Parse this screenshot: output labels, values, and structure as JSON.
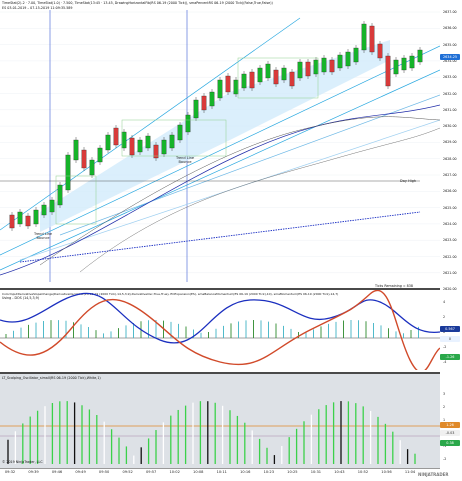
{
  "price_chart": {
    "header_line1": "TimeStat(2)-2 · 7.00, TimeStat(1.0) · 7.500, TimeStat(13:45 · 13.45, DrawingHorizontalFib(RS 06-19 (2000 Tick)), smaPercentRS 06-19 (2000 Tick)(False,True,False))",
    "header_line2": "ES 03-01-2019 – 07-15-2019 11:09:35.589",
    "price_ticks": [
      "2637.00",
      "2636.00",
      "2635.00",
      "2634.00",
      "2633.00",
      "2632.00",
      "2631.00",
      "2630.00",
      "2629.00",
      "2628.00",
      "2627.00",
      "2626.00",
      "2625.00",
      "2624.00",
      "2623.00",
      "2622.00",
      "2621.00",
      "2620.00"
    ],
    "price_badge": "2634.25",
    "badge_color": "#1f6fd6",
    "annotations": [
      {
        "name": "bounce-1",
        "text": "Trend Line\nBounce"
      },
      {
        "name": "bounce-2",
        "text": "Trend Line\nBounce"
      },
      {
        "name": "day-high",
        "text": "Day High"
      }
    ],
    "ticks_remaining": "Ticks Remaining = 838"
  },
  "indicator1": {
    "header": "ColorInputDerivativeSlopeChange(DerivativeOscillator(ES 06-19 (2000 Tick),14,5,3,9),DerivativeOsc,True,True), ECExpansion(ES), smaBalanceMomentum(ES 06-19 (2000 Tick),10), smaMomentum(ES 06-19 (2000 Tick),14,7)",
    "subheader": "Using - DOS (14,5,3,9)",
    "ticks": [
      "4",
      "2",
      "0",
      "-2",
      "-4"
    ],
    "badge_top": "0.567",
    "badge_top_color": "#1a3a9a",
    "badge_bottom": "-1.26",
    "badge_bottom_color": "#2aa84a",
    "badge_mid": "0",
    "badge_mid_color": "#e9f2ff"
  },
  "indicator2": {
    "header": "LT_Scalping_Oscillator_simaII(RS 06-19 (2000 Tick),White,1)",
    "ticks": [
      "3",
      "2",
      "1",
      "0",
      "-1",
      "-2"
    ],
    "badge_top": "1.26",
    "badge_top_color": "#e08a2a",
    "badge_mid": "-0.03",
    "badge_mid_color": "#f0f0f0",
    "badge_bottom": "0.38",
    "badge_bottom_color": "#2aa84a",
    "footer": "© 2019 NinjaTrader, LLC"
  },
  "time_axis": [
    "09:32",
    "09:39",
    "09:46",
    "09:49",
    "09:50",
    "09:52",
    "09:57",
    "10:02",
    "10:08",
    "10:11",
    "10:16",
    "10:23",
    "10:25",
    "10:31",
    "10:43",
    "10:52",
    "10:56",
    "11:04"
  ],
  "logo": "NINJATRADER"
}
